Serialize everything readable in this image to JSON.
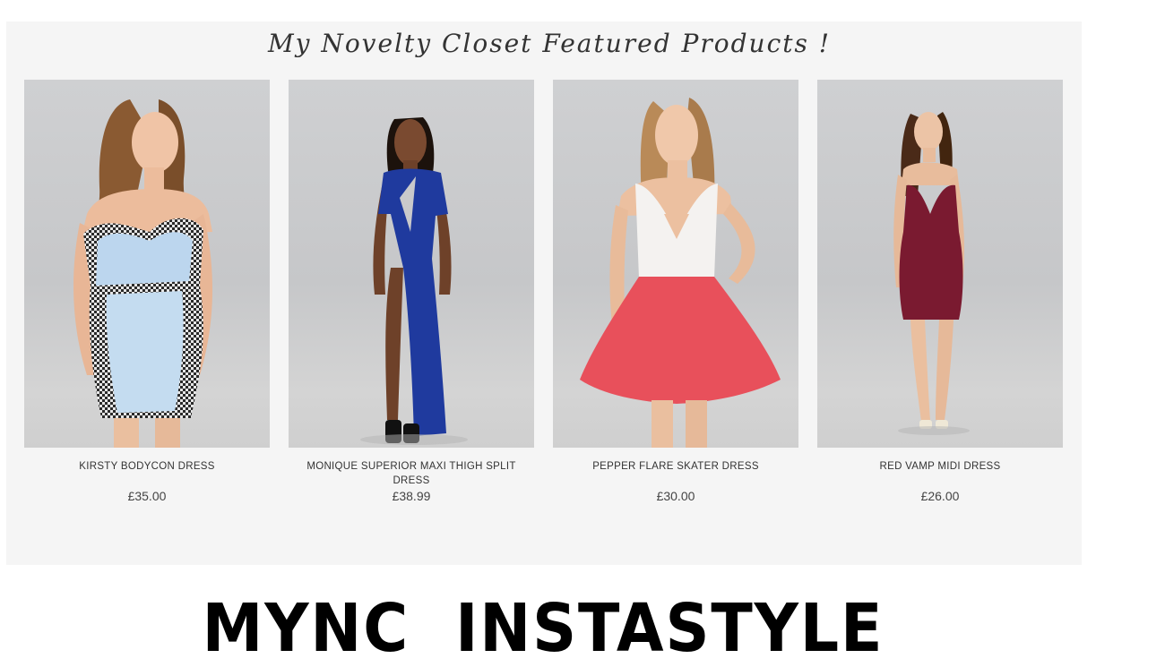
{
  "featured": {
    "title": "My Novelty Closet Featured Products !",
    "products": [
      {
        "name": "KIRSTY BODYCON DRESS",
        "price": "£35.00",
        "image_icon": "model-houndstooth-bodycon-dress"
      },
      {
        "name": "MONIQUE SUPERIOR MAXI THIGH SPLIT DRESS",
        "price": "£38.99",
        "image_icon": "model-blue-maxi-split-dress"
      },
      {
        "name": "PEPPER FLARE SKATER DRESS",
        "price": "£30.00",
        "image_icon": "model-white-coral-skater-dress"
      },
      {
        "name": "RED VAMP MIDI DRESS",
        "price": "£26.00",
        "image_icon": "model-burgundy-midi-dress"
      }
    ]
  },
  "banner": {
    "text": "MYNC  INSTASTYLE"
  },
  "colors": {
    "panel_background": "#f5f5f5",
    "text": "#333333",
    "dress_blue": "#1f3a9e",
    "dress_coral": "#e8505b",
    "dress_burgundy": "#7a1a30"
  }
}
